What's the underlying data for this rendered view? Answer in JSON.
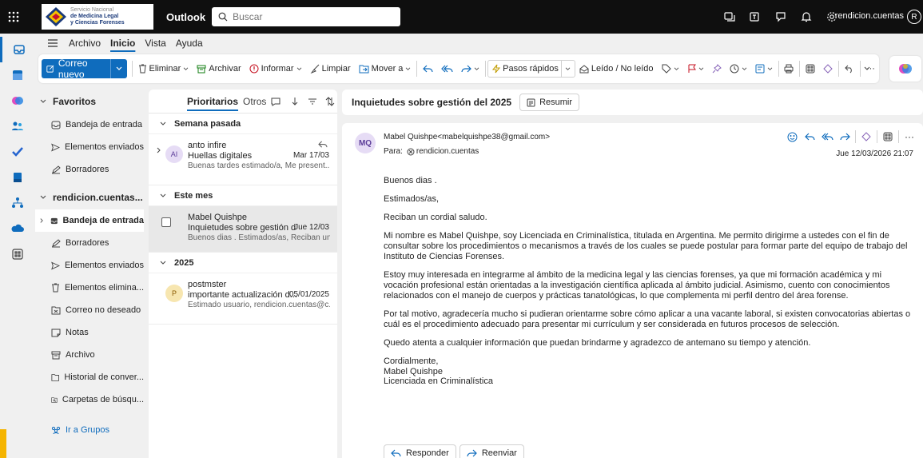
{
  "topbar": {
    "brand_lines": [
      "Servicio Nacional",
      "de Medicina Legal",
      "y Ciencias Forenses"
    ],
    "app_name": "Outlook",
    "search_placeholder": "Buscar",
    "user_name": "rendicion.cuentas",
    "user_initial": "R"
  },
  "menu": {
    "items": [
      "Archivo",
      "Inicio",
      "Vista",
      "Ayuda"
    ],
    "active": "Inicio"
  },
  "ribbon": {
    "new_mail": "Correo nuevo",
    "delete": "Eliminar",
    "archive": "Archivar",
    "report": "Informar",
    "sweep": "Limpiar",
    "move": "Mover a",
    "quick_steps": "Pasos rápidos",
    "read_unread": "Leído / No leído",
    "more": "···"
  },
  "folders": {
    "favorites_header": "Favoritos",
    "favorites": [
      "Bandeja de entrada",
      "Elementos enviados",
      "Borradores"
    ],
    "account_header": "rendicion.cuentas...",
    "account_items": [
      "Bandeja de entrada",
      "Borradores",
      "Elementos enviados",
      "Elementos elimina...",
      "Correo no deseado",
      "Notas",
      "Archivo",
      "Historial de conver...",
      "Carpetas de búsqu..."
    ],
    "groups_link": "Ir a Grupos"
  },
  "list": {
    "tab_focused": "Prioritarios",
    "tab_other": "Otros",
    "groups": [
      {
        "label": "Semana pasada",
        "messages": [
          {
            "initials": "AI",
            "sender": "anto infire",
            "subject": "Huellas digitales",
            "date": "Mar 17/03",
            "preview": "Buenas tardes estimado/a, Me present..."
          }
        ]
      },
      {
        "label": "Este mes",
        "messages": [
          {
            "initials": "",
            "sender": "Mabel Quishpe",
            "subject": "Inquietudes sobre gestión d...",
            "date": "Jue 12/03",
            "preview": "Buenos dias . Estimados/as, Reciban un..."
          }
        ]
      },
      {
        "label": "2025",
        "messages": [
          {
            "initials": "P",
            "sender": "postmster",
            "subject": "importante actualización d...",
            "date": "05/01/2025",
            "preview": "Estimado usuario, rendicion.cuentas@c..."
          }
        ]
      }
    ]
  },
  "reading": {
    "subject": "Inquietudes sobre gestión del 2025",
    "summarize": "Resumir",
    "sender_initials": "MQ",
    "from": "Mabel Quishpe<mabelquishpe38@gmail.com>",
    "to_label": "Para:",
    "to": "rendicion.cuentas",
    "date": "Jue 12/03/2026 21:07",
    "body": [
      "Buenos dias .",
      "Estimados/as,",
      "Reciban un cordial saludo.",
      "Mi nombre es Mabel Quishpe, soy Licenciada en Criminalística, titulada en Argentina. Me permito dirigirme a ustedes con el fin de consultar sobre los procedimientos o mecanismos a través de los cuales se puede postular para formar parte del equipo de trabajo del Instituto de Ciencias Forenses.",
      "Estoy muy interesada en integrarme al ámbito de la medicina legal y las ciencias forenses, ya que mi formación académica y mi vocación profesional están orientadas a la investigación científica aplicada al ámbito judicial. Asimismo, cuento con conocimientos relacionados con el manejo de cuerpos y prácticas tanatológicas, lo que complementa mi perfil dentro del área forense.",
      "Por tal motivo, agradecería mucho si pudieran orientarme sobre cómo aplicar a una vacante laboral, si existen convocatorias abiertas o cuál es el procedimiento adecuado para presentar mi currículum y ser considerada en futuros procesos de selección.",
      "Quedo atenta a cualquier información que puedan brindarme y agradezco de antemano su tiempo y atención."
    ],
    "signature": [
      "Cordialmente,",
      "Mabel Quishpe",
      "Licenciada en Criminalística"
    ],
    "reply": "Responder",
    "forward": "Reenviar"
  },
  "colors": {
    "accent": "#0f6cbd",
    "topbar": "#0f0f0f",
    "avatar_ai": "#e6dcf5",
    "avatar_p": "#f7e6b0"
  }
}
